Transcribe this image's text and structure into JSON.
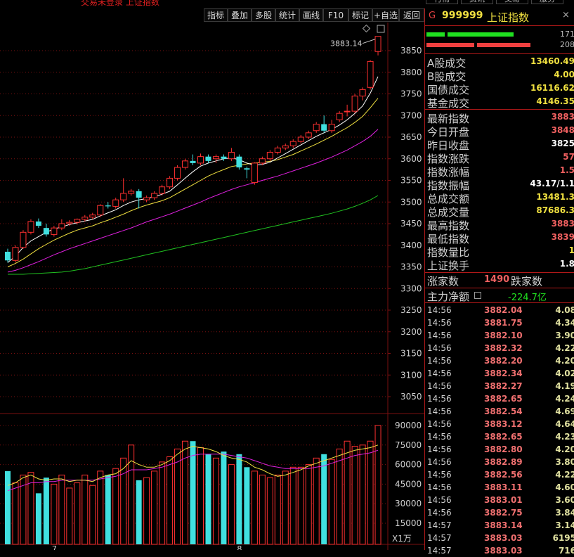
{
  "topbar": {
    "crumb": "交易未登录  上证指数",
    "tools": [
      "指标",
      "叠加",
      "多股",
      "统计",
      "画线",
      "F10",
      "标记",
      "+自选",
      "返回"
    ],
    "right_tabs": [
      "行情",
      "资讯",
      "交易",
      "服务"
    ]
  },
  "stock": {
    "prefix": "G",
    "code": "999999",
    "name": "上证指数",
    "close_glyph": "×"
  },
  "bars": {
    "up_count": "171",
    "down_count": "208"
  },
  "turnover": [
    {
      "label": "A股成交",
      "value": "13460.49",
      "color": "#f0e040"
    },
    {
      "label": "B股成交",
      "value": "4.00",
      "color": "#f0e040"
    },
    {
      "label": "国债成交",
      "value": "16116.62",
      "color": "#f0e040"
    },
    {
      "label": "基金成交",
      "value": "4146.35",
      "color": "#f0e040"
    }
  ],
  "quote": [
    {
      "label": "最新指数",
      "value": "3883",
      "color": "#f06060"
    },
    {
      "label": "今日开盘",
      "value": "3848",
      "color": "#f06060"
    },
    {
      "label": "昨日收盘",
      "value": "3825",
      "color": "#ffffff"
    },
    {
      "label": "指数涨跌",
      "value": "57",
      "color": "#f06060"
    },
    {
      "label": "指数涨幅",
      "value": "1.5",
      "color": "#f06060"
    },
    {
      "label": "指数振幅",
      "value": "43.17/1.1",
      "color": "#ffffff"
    },
    {
      "label": "总成交额",
      "value": "13481.3",
      "color": "#f0e040"
    },
    {
      "label": "总成交量",
      "value": "87686.3",
      "color": "#f0e040"
    },
    {
      "label": "最高指数",
      "value": "3883",
      "color": "#f06060"
    },
    {
      "label": "最低指数",
      "value": "3839",
      "color": "#f06060"
    },
    {
      "label": "指数量比",
      "value": "1",
      "color": "#f0e040"
    },
    {
      "label": "上证换手",
      "value": "1.8",
      "color": "#ffffff"
    }
  ],
  "breadth": {
    "up_label": "涨家数",
    "up_value": "1490",
    "down_label": "跌家数"
  },
  "flow": {
    "label": "主力净额",
    "value": "-224.7亿"
  },
  "ticks": [
    {
      "t": "14:56",
      "p": "3882.04",
      "v": "4.08"
    },
    {
      "t": "14:56",
      "p": "3881.75",
      "v": "4.34"
    },
    {
      "t": "14:56",
      "p": "3882.10",
      "v": "3.90"
    },
    {
      "t": "14:56",
      "p": "3882.32",
      "v": "4.22"
    },
    {
      "t": "14:56",
      "p": "3882.20",
      "v": "4.20"
    },
    {
      "t": "14:56",
      "p": "3882.34",
      "v": "4.02"
    },
    {
      "t": "14:56",
      "p": "3882.27",
      "v": "4.19"
    },
    {
      "t": "14:56",
      "p": "3882.65",
      "v": "4.24"
    },
    {
      "t": "14:56",
      "p": "3882.54",
      "v": "4.69"
    },
    {
      "t": "14:56",
      "p": "3883.12",
      "v": "4.64"
    },
    {
      "t": "14:56",
      "p": "3882.65",
      "v": "4.23"
    },
    {
      "t": "14:56",
      "p": "3882.80",
      "v": "4.20"
    },
    {
      "t": "14:56",
      "p": "3882.89",
      "v": "3.80"
    },
    {
      "t": "14:56",
      "p": "3882.56",
      "v": "4.22"
    },
    {
      "t": "14:56",
      "p": "3883.11",
      "v": "4.60"
    },
    {
      "t": "14:56",
      "p": "3883.01",
      "v": "3.60"
    },
    {
      "t": "14:56",
      "p": "3882.75",
      "v": "3.84"
    },
    {
      "t": "14:57",
      "p": "3883.14",
      "v": "3.14"
    },
    {
      "t": "14:57",
      "p": "3883.03",
      "v": "6195"
    },
    {
      "t": "14:57",
      "p": "3883.03",
      "v": "716"
    }
  ],
  "chart_data": {
    "type": "candlestick",
    "price_axis": [
      "3850",
      "3800",
      "3750",
      "3700",
      "3650",
      "3600",
      "3550",
      "3500",
      "3450",
      "3400",
      "3350",
      "3300",
      "3250",
      "3200",
      "3150",
      "3100",
      "3050"
    ],
    "volume_axis": [
      "90000",
      "75000",
      "60000",
      "45000",
      "30000",
      "15000"
    ],
    "volume_unit": "X1万",
    "latest_label": "3883.14",
    "x_labels": [
      "7",
      "8"
    ],
    "colors": {
      "up": "#ff3030",
      "down": "#40e0e0",
      "ma5": "#ffffff",
      "ma10": "#f0e040",
      "ma20": "#e020e0",
      "ma60": "#20c020",
      "grid": "#7a1010"
    },
    "candles": [
      {
        "o": 3385,
        "c": 3365,
        "h": 3392,
        "l": 3360
      },
      {
        "o": 3365,
        "c": 3395,
        "h": 3400,
        "l": 3360
      },
      {
        "o": 3395,
        "c": 3430,
        "h": 3435,
        "l": 3392
      },
      {
        "o": 3430,
        "c": 3455,
        "h": 3460,
        "l": 3425
      },
      {
        "o": 3455,
        "c": 3445,
        "h": 3462,
        "l": 3440
      },
      {
        "o": 3440,
        "c": 3425,
        "h": 3450,
        "l": 3420
      },
      {
        "o": 3425,
        "c": 3440,
        "h": 3445,
        "l": 3420
      },
      {
        "o": 3440,
        "c": 3450,
        "h": 3460,
        "l": 3435
      },
      {
        "o": 3450,
        "c": 3453,
        "h": 3458,
        "l": 3445
      },
      {
        "o": 3453,
        "c": 3460,
        "h": 3462,
        "l": 3448
      },
      {
        "o": 3460,
        "c": 3465,
        "h": 3470,
        "l": 3455
      },
      {
        "o": 3465,
        "c": 3470,
        "h": 3475,
        "l": 3460
      },
      {
        "o": 3470,
        "c": 3492,
        "h": 3495,
        "l": 3465
      },
      {
        "o": 3492,
        "c": 3490,
        "h": 3500,
        "l": 3485
      },
      {
        "o": 3490,
        "c": 3505,
        "h": 3510,
        "l": 3485
      },
      {
        "o": 3505,
        "c": 3520,
        "h": 3555,
        "l": 3500
      },
      {
        "o": 3520,
        "c": 3525,
        "h": 3530,
        "l": 3515
      },
      {
        "o": 3525,
        "c": 3510,
        "h": 3530,
        "l": 3485
      },
      {
        "o": 3505,
        "c": 3510,
        "h": 3515,
        "l": 3500
      },
      {
        "o": 3510,
        "c": 3520,
        "h": 3525,
        "l": 3505
      },
      {
        "o": 3520,
        "c": 3535,
        "h": 3540,
        "l": 3515
      },
      {
        "o": 3535,
        "c": 3555,
        "h": 3560,
        "l": 3530
      },
      {
        "o": 3555,
        "c": 3580,
        "h": 3585,
        "l": 3550
      },
      {
        "o": 3580,
        "c": 3595,
        "h": 3600,
        "l": 3575
      },
      {
        "o": 3595,
        "c": 3590,
        "h": 3610,
        "l": 3585
      },
      {
        "o": 3590,
        "c": 3605,
        "h": 3612,
        "l": 3585
      },
      {
        "o": 3605,
        "c": 3595,
        "h": 3610,
        "l": 3590
      },
      {
        "o": 3600,
        "c": 3605,
        "h": 3610,
        "l": 3590
      },
      {
        "o": 3605,
        "c": 3600,
        "h": 3610,
        "l": 3595
      },
      {
        "o": 3600,
        "c": 3615,
        "h": 3625,
        "l": 3595
      },
      {
        "o": 3605,
        "c": 3580,
        "h": 3610,
        "l": 3575
      },
      {
        "o": 3578,
        "c": 3575,
        "h": 3582,
        "l": 3555
      },
      {
        "o": 3545,
        "c": 3590,
        "h": 3592,
        "l": 3540
      },
      {
        "o": 3590,
        "c": 3600,
        "h": 3605,
        "l": 3585
      },
      {
        "o": 3600,
        "c": 3615,
        "h": 3620,
        "l": 3595
      },
      {
        "o": 3615,
        "c": 3625,
        "h": 3630,
        "l": 3610
      },
      {
        "o": 3625,
        "c": 3630,
        "h": 3635,
        "l": 3620
      },
      {
        "o": 3630,
        "c": 3640,
        "h": 3645,
        "l": 3625
      },
      {
        "o": 3640,
        "c": 3650,
        "h": 3655,
        "l": 3635
      },
      {
        "o": 3650,
        "c": 3660,
        "h": 3665,
        "l": 3645
      },
      {
        "o": 3665,
        "c": 3680,
        "h": 3685,
        "l": 3660
      },
      {
        "o": 3680,
        "c": 3665,
        "h": 3700,
        "l": 3660
      },
      {
        "o": 3665,
        "c": 3680,
        "h": 3690,
        "l": 3660
      },
      {
        "o": 3690,
        "c": 3705,
        "h": 3710,
        "l": 3685
      },
      {
        "o": 3710,
        "c": 3710,
        "h": 3725,
        "l": 3698
      },
      {
        "o": 3710,
        "c": 3745,
        "h": 3750,
        "l": 3705
      },
      {
        "o": 3745,
        "c": 3760,
        "h": 3765,
        "l": 3735
      },
      {
        "o": 3765,
        "c": 3825,
        "h": 3828,
        "l": 3760
      },
      {
        "o": 3848,
        "c": 3883,
        "h": 3883,
        "l": 3839
      }
    ],
    "ma5": [
      3360,
      3375,
      3395,
      3410,
      3420,
      3430,
      3438,
      3442,
      3448,
      3452,
      3456,
      3460,
      3468,
      3475,
      3482,
      3492,
      3500,
      3505,
      3508,
      3512,
      3518,
      3525,
      3540,
      3555,
      3570,
      3583,
      3590,
      3595,
      3600,
      3602,
      3598,
      3590,
      3585,
      3587,
      3592,
      3602,
      3612,
      3622,
      3632,
      3642,
      3652,
      3660,
      3668,
      3678,
      3690,
      3705,
      3722,
      3752,
      3790
    ],
    "ma10": [
      3350,
      3358,
      3368,
      3380,
      3392,
      3402,
      3412,
      3420,
      3428,
      3435,
      3440,
      3445,
      3452,
      3458,
      3465,
      3472,
      3480,
      3487,
      3493,
      3498,
      3503,
      3510,
      3520,
      3530,
      3540,
      3550,
      3560,
      3568,
      3575,
      3582,
      3585,
      3588,
      3590,
      3592,
      3594,
      3598,
      3604,
      3610,
      3618,
      3626,
      3634,
      3643,
      3652,
      3662,
      3672,
      3684,
      3698,
      3718,
      3740
    ],
    "ma20": [
      3338,
      3342,
      3348,
      3355,
      3362,
      3370,
      3378,
      3385,
      3392,
      3398,
      3404,
      3410,
      3416,
      3422,
      3428,
      3434,
      3440,
      3447,
      3454,
      3460,
      3466,
      3472,
      3479,
      3486,
      3493,
      3500,
      3508,
      3515,
      3522,
      3529,
      3535,
      3540,
      3545,
      3550,
      3555,
      3560,
      3566,
      3572,
      3578,
      3584,
      3590,
      3597,
      3604,
      3612,
      3620,
      3630,
      3640,
      3652,
      3668
    ],
    "ma60": [
      3333,
      3333,
      3333,
      3334,
      3335,
      3336,
      3337,
      3338,
      3340,
      3343,
      3346,
      3350,
      3354,
      3358,
      3362,
      3366,
      3370,
      3374,
      3378,
      3382,
      3386,
      3390,
      3394,
      3398,
      3402,
      3406,
      3410,
      3414,
      3418,
      3422,
      3426,
      3430,
      3434,
      3438,
      3442,
      3446,
      3450,
      3454,
      3458,
      3462,
      3466,
      3470,
      3474,
      3479,
      3484,
      3490,
      3497,
      3505,
      3515
    ],
    "volumes": [
      55000,
      46000,
      52000,
      54000,
      38000,
      50000,
      45000,
      52000,
      42000,
      46000,
      52000,
      44000,
      55000,
      52000,
      57000,
      65000,
      75000,
      48000,
      50000,
      55000,
      62000,
      66000,
      72000,
      78000,
      78000,
      73000,
      68000,
      65000,
      70000,
      60000,
      68000,
      58000,
      55000,
      52000,
      50000,
      52000,
      55000,
      58000,
      58000,
      60000,
      65000,
      68000,
      64000,
      72000,
      78000,
      74000,
      75000,
      78000,
      90000
    ],
    "vol_ma5": [
      44000,
      46000,
      50000,
      52000,
      49000,
      48000,
      49000,
      49000,
      47000,
      48000,
      48000,
      47000,
      50000,
      52000,
      53000,
      57000,
      63000,
      60000,
      58000,
      58000,
      60000,
      63000,
      68000,
      72000,
      74000,
      73000,
      72000,
      70000,
      67000,
      65000,
      64000,
      62000,
      58000,
      56000,
      53000,
      51000,
      52000,
      54000,
      56000,
      59000,
      61000,
      63000,
      65000,
      67000,
      69000,
      71000,
      72000,
      73000,
      75000
    ],
    "vol_ma10": [
      40000,
      42000,
      44000,
      46000,
      46000,
      47000,
      47000,
      48000,
      48000,
      48000,
      48000,
      48000,
      49000,
      50000,
      51000,
      53000,
      56000,
      56000,
      56000,
      57000,
      58000,
      60000,
      62000,
      65000,
      67000,
      68000,
      68000,
      68000,
      68000,
      67000,
      66000,
      65000,
      63000,
      61000,
      59000,
      58000,
      57000,
      57000,
      57000,
      57000,
      58000,
      59000,
      61000,
      63000,
      65000,
      67000,
      68000,
      69000,
      71000
    ]
  }
}
